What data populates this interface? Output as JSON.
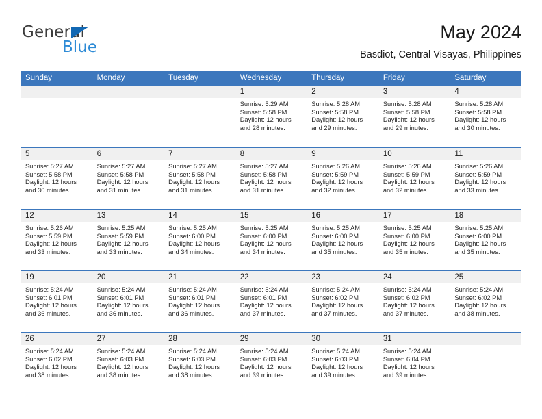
{
  "brand": {
    "name_part1": "General",
    "name_part2": "Blue",
    "accent_color": "#2e8bd6",
    "triangle_color": "#1268b3"
  },
  "header": {
    "title": "May 2024",
    "subtitle": "Basdiot, Central Visayas, Philippines"
  },
  "calendar": {
    "header_color": "#3c77bd",
    "weekday_headers": [
      "Sunday",
      "Monday",
      "Tuesday",
      "Wednesday",
      "Thursday",
      "Friday",
      "Saturday"
    ],
    "weeks": [
      [
        {
          "day": "",
          "empty": true
        },
        {
          "day": "",
          "empty": true
        },
        {
          "day": "",
          "empty": true
        },
        {
          "day": "1",
          "sunrise": "Sunrise: 5:29 AM",
          "sunset": "Sunset: 5:58 PM",
          "daylight_line1": "Daylight: 12 hours",
          "daylight_line2": "and 28 minutes."
        },
        {
          "day": "2",
          "sunrise": "Sunrise: 5:28 AM",
          "sunset": "Sunset: 5:58 PM",
          "daylight_line1": "Daylight: 12 hours",
          "daylight_line2": "and 29 minutes."
        },
        {
          "day": "3",
          "sunrise": "Sunrise: 5:28 AM",
          "sunset": "Sunset: 5:58 PM",
          "daylight_line1": "Daylight: 12 hours",
          "daylight_line2": "and 29 minutes."
        },
        {
          "day": "4",
          "sunrise": "Sunrise: 5:28 AM",
          "sunset": "Sunset: 5:58 PM",
          "daylight_line1": "Daylight: 12 hours",
          "daylight_line2": "and 30 minutes."
        }
      ],
      [
        {
          "day": "5",
          "sunrise": "Sunrise: 5:27 AM",
          "sunset": "Sunset: 5:58 PM",
          "daylight_line1": "Daylight: 12 hours",
          "daylight_line2": "and 30 minutes."
        },
        {
          "day": "6",
          "sunrise": "Sunrise: 5:27 AM",
          "sunset": "Sunset: 5:58 PM",
          "daylight_line1": "Daylight: 12 hours",
          "daylight_line2": "and 31 minutes."
        },
        {
          "day": "7",
          "sunrise": "Sunrise: 5:27 AM",
          "sunset": "Sunset: 5:58 PM",
          "daylight_line1": "Daylight: 12 hours",
          "daylight_line2": "and 31 minutes."
        },
        {
          "day": "8",
          "sunrise": "Sunrise: 5:27 AM",
          "sunset": "Sunset: 5:58 PM",
          "daylight_line1": "Daylight: 12 hours",
          "daylight_line2": "and 31 minutes."
        },
        {
          "day": "9",
          "sunrise": "Sunrise: 5:26 AM",
          "sunset": "Sunset: 5:59 PM",
          "daylight_line1": "Daylight: 12 hours",
          "daylight_line2": "and 32 minutes."
        },
        {
          "day": "10",
          "sunrise": "Sunrise: 5:26 AM",
          "sunset": "Sunset: 5:59 PM",
          "daylight_line1": "Daylight: 12 hours",
          "daylight_line2": "and 32 minutes."
        },
        {
          "day": "11",
          "sunrise": "Sunrise: 5:26 AM",
          "sunset": "Sunset: 5:59 PM",
          "daylight_line1": "Daylight: 12 hours",
          "daylight_line2": "and 33 minutes."
        }
      ],
      [
        {
          "day": "12",
          "sunrise": "Sunrise: 5:26 AM",
          "sunset": "Sunset: 5:59 PM",
          "daylight_line1": "Daylight: 12 hours",
          "daylight_line2": "and 33 minutes."
        },
        {
          "day": "13",
          "sunrise": "Sunrise: 5:25 AM",
          "sunset": "Sunset: 5:59 PM",
          "daylight_line1": "Daylight: 12 hours",
          "daylight_line2": "and 33 minutes."
        },
        {
          "day": "14",
          "sunrise": "Sunrise: 5:25 AM",
          "sunset": "Sunset: 6:00 PM",
          "daylight_line1": "Daylight: 12 hours",
          "daylight_line2": "and 34 minutes."
        },
        {
          "day": "15",
          "sunrise": "Sunrise: 5:25 AM",
          "sunset": "Sunset: 6:00 PM",
          "daylight_line1": "Daylight: 12 hours",
          "daylight_line2": "and 34 minutes."
        },
        {
          "day": "16",
          "sunrise": "Sunrise: 5:25 AM",
          "sunset": "Sunset: 6:00 PM",
          "daylight_line1": "Daylight: 12 hours",
          "daylight_line2": "and 35 minutes."
        },
        {
          "day": "17",
          "sunrise": "Sunrise: 5:25 AM",
          "sunset": "Sunset: 6:00 PM",
          "daylight_line1": "Daylight: 12 hours",
          "daylight_line2": "and 35 minutes."
        },
        {
          "day": "18",
          "sunrise": "Sunrise: 5:25 AM",
          "sunset": "Sunset: 6:00 PM",
          "daylight_line1": "Daylight: 12 hours",
          "daylight_line2": "and 35 minutes."
        }
      ],
      [
        {
          "day": "19",
          "sunrise": "Sunrise: 5:24 AM",
          "sunset": "Sunset: 6:01 PM",
          "daylight_line1": "Daylight: 12 hours",
          "daylight_line2": "and 36 minutes."
        },
        {
          "day": "20",
          "sunrise": "Sunrise: 5:24 AM",
          "sunset": "Sunset: 6:01 PM",
          "daylight_line1": "Daylight: 12 hours",
          "daylight_line2": "and 36 minutes."
        },
        {
          "day": "21",
          "sunrise": "Sunrise: 5:24 AM",
          "sunset": "Sunset: 6:01 PM",
          "daylight_line1": "Daylight: 12 hours",
          "daylight_line2": "and 36 minutes."
        },
        {
          "day": "22",
          "sunrise": "Sunrise: 5:24 AM",
          "sunset": "Sunset: 6:01 PM",
          "daylight_line1": "Daylight: 12 hours",
          "daylight_line2": "and 37 minutes."
        },
        {
          "day": "23",
          "sunrise": "Sunrise: 5:24 AM",
          "sunset": "Sunset: 6:02 PM",
          "daylight_line1": "Daylight: 12 hours",
          "daylight_line2": "and 37 minutes."
        },
        {
          "day": "24",
          "sunrise": "Sunrise: 5:24 AM",
          "sunset": "Sunset: 6:02 PM",
          "daylight_line1": "Daylight: 12 hours",
          "daylight_line2": "and 37 minutes."
        },
        {
          "day": "25",
          "sunrise": "Sunrise: 5:24 AM",
          "sunset": "Sunset: 6:02 PM",
          "daylight_line1": "Daylight: 12 hours",
          "daylight_line2": "and 38 minutes."
        }
      ],
      [
        {
          "day": "26",
          "sunrise": "Sunrise: 5:24 AM",
          "sunset": "Sunset: 6:02 PM",
          "daylight_line1": "Daylight: 12 hours",
          "daylight_line2": "and 38 minutes."
        },
        {
          "day": "27",
          "sunrise": "Sunrise: 5:24 AM",
          "sunset": "Sunset: 6:03 PM",
          "daylight_line1": "Daylight: 12 hours",
          "daylight_line2": "and 38 minutes."
        },
        {
          "day": "28",
          "sunrise": "Sunrise: 5:24 AM",
          "sunset": "Sunset: 6:03 PM",
          "daylight_line1": "Daylight: 12 hours",
          "daylight_line2": "and 38 minutes."
        },
        {
          "day": "29",
          "sunrise": "Sunrise: 5:24 AM",
          "sunset": "Sunset: 6:03 PM",
          "daylight_line1": "Daylight: 12 hours",
          "daylight_line2": "and 39 minutes."
        },
        {
          "day": "30",
          "sunrise": "Sunrise: 5:24 AM",
          "sunset": "Sunset: 6:03 PM",
          "daylight_line1": "Daylight: 12 hours",
          "daylight_line2": "and 39 minutes."
        },
        {
          "day": "31",
          "sunrise": "Sunrise: 5:24 AM",
          "sunset": "Sunset: 6:04 PM",
          "daylight_line1": "Daylight: 12 hours",
          "daylight_line2": "and 39 minutes."
        },
        {
          "day": "",
          "empty": true
        }
      ]
    ]
  }
}
